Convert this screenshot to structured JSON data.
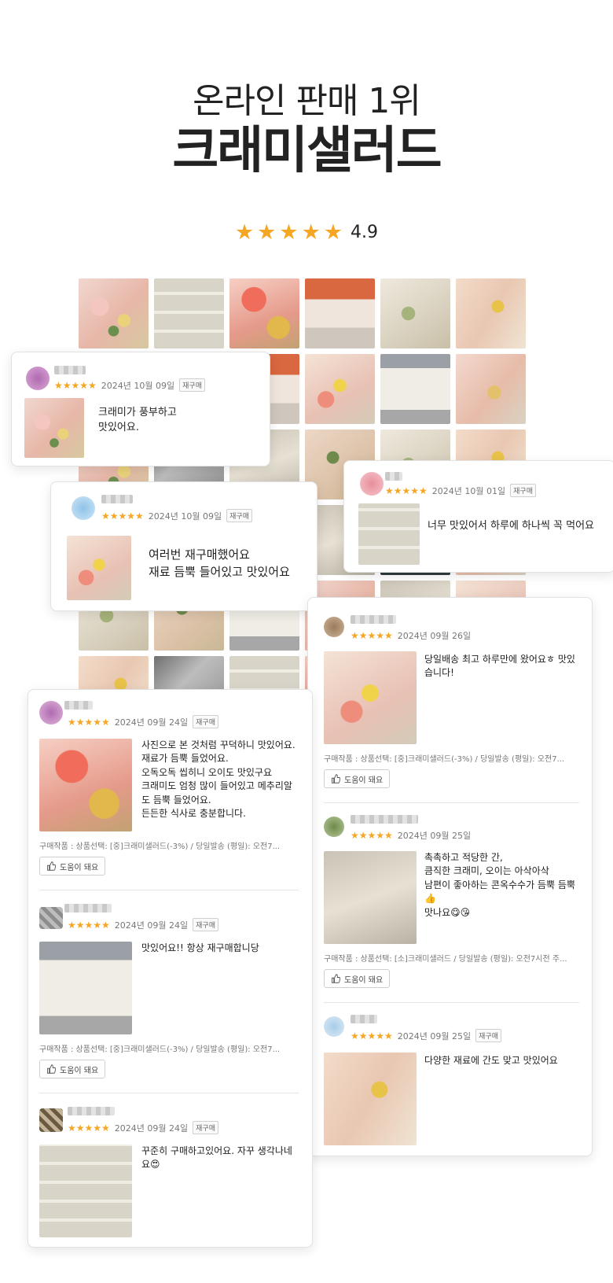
{
  "header": {
    "subtitle": "온라인 판매 1위",
    "title": "크래미샐러드"
  },
  "rating": {
    "stars": "★★★★★",
    "score": "4.9"
  },
  "photo_grid_images": [
    "salad-photo",
    "salad-photo",
    "salad-photo",
    "salad-photo",
    "salad-photo",
    "salad-photo"
  ],
  "reviews": [
    {
      "stars": "★★★★★",
      "date": "2024년 10월 09일",
      "badge": "재구매",
      "text": "크래미가 풍부하고\n맛있어요."
    },
    {
      "stars": "★★★★★",
      "date": "2024년 10월 09일",
      "badge": "재구매",
      "text": "여러번 재구매했어요\n재료 듬뿍 들어있고 맛있어요"
    },
    {
      "stars": "★★★★★",
      "date": "2024년 10월 01일",
      "badge": "재구매",
      "text": "너무 맛있어서 하루에 하나씩 꼭 먹어요"
    },
    {
      "stars": "★★★★★",
      "date": "2024년 09월 26일",
      "badge": "",
      "text": "당일배송 최고 하루만에 왔어요ㅎ 맛있\n습니다!",
      "purchase": "구매작품 : 상품선택: [중]크래미샐러드(-3%) / 당일발송 (평일): 오전7...",
      "help": "도움이 돼요"
    },
    {
      "stars": "★★★★★",
      "date": "2024년 09월 25일",
      "badge": "",
      "text": "촉촉하고 적당한 간,\n큼직한 크래미, 오이는 아삭아삭\n남편이 좋아하는 콘옥수수가 듬뿍 듬뿍\n👍\n맛나요😋😘",
      "purchase": "구매작품 : 상품선택: [소]크래미샐러드 / 당일발송 (평일): 오전7시전 주...",
      "help": "도움이 돼요"
    },
    {
      "stars": "★★★★★",
      "date": "2024년 09월 25일",
      "badge": "재구매",
      "text": "다양한 재료에 간도 맞고 맛있어요"
    },
    {
      "stars": "★★★★★",
      "date": "2024년 09월 24일",
      "badge": "재구매",
      "text": "사진으로 본 것처럼 꾸덕하니 맛있어요.\n재료가 듬뿍 들었어요.\n오독오독 씹히니 오이도 맛있구요\n크래미도 엄청 많이 들어있고 메추리알\n도 듬뿍 들었어요.\n든든한 식사로 충분합니다.",
      "purchase": "구매작품 : 상품선택: [중]크래미샐러드(-3%) / 당일발송 (평일): 오전7...",
      "help": "도움이 돼요"
    },
    {
      "stars": "★★★★★",
      "date": "2024년 09월 24일",
      "badge": "재구매",
      "text": "맛있어요!! 항상 재구매합니당",
      "purchase": "구매작품 : 상품선택: [중]크래미샐러드(-3%) / 당일발송 (평일): 오전7...",
      "help": "도움이 돼요"
    },
    {
      "stars": "★★★★★",
      "date": "2024년 09월 24일",
      "badge": "재구매",
      "text": "꾸준히 구매하고있어요. 자꾸 생각나네\n요😍"
    }
  ],
  "colors": {
    "star": "#f5a623",
    "text": "#222222",
    "muted": "#777777",
    "border": "#e2e2e2"
  }
}
